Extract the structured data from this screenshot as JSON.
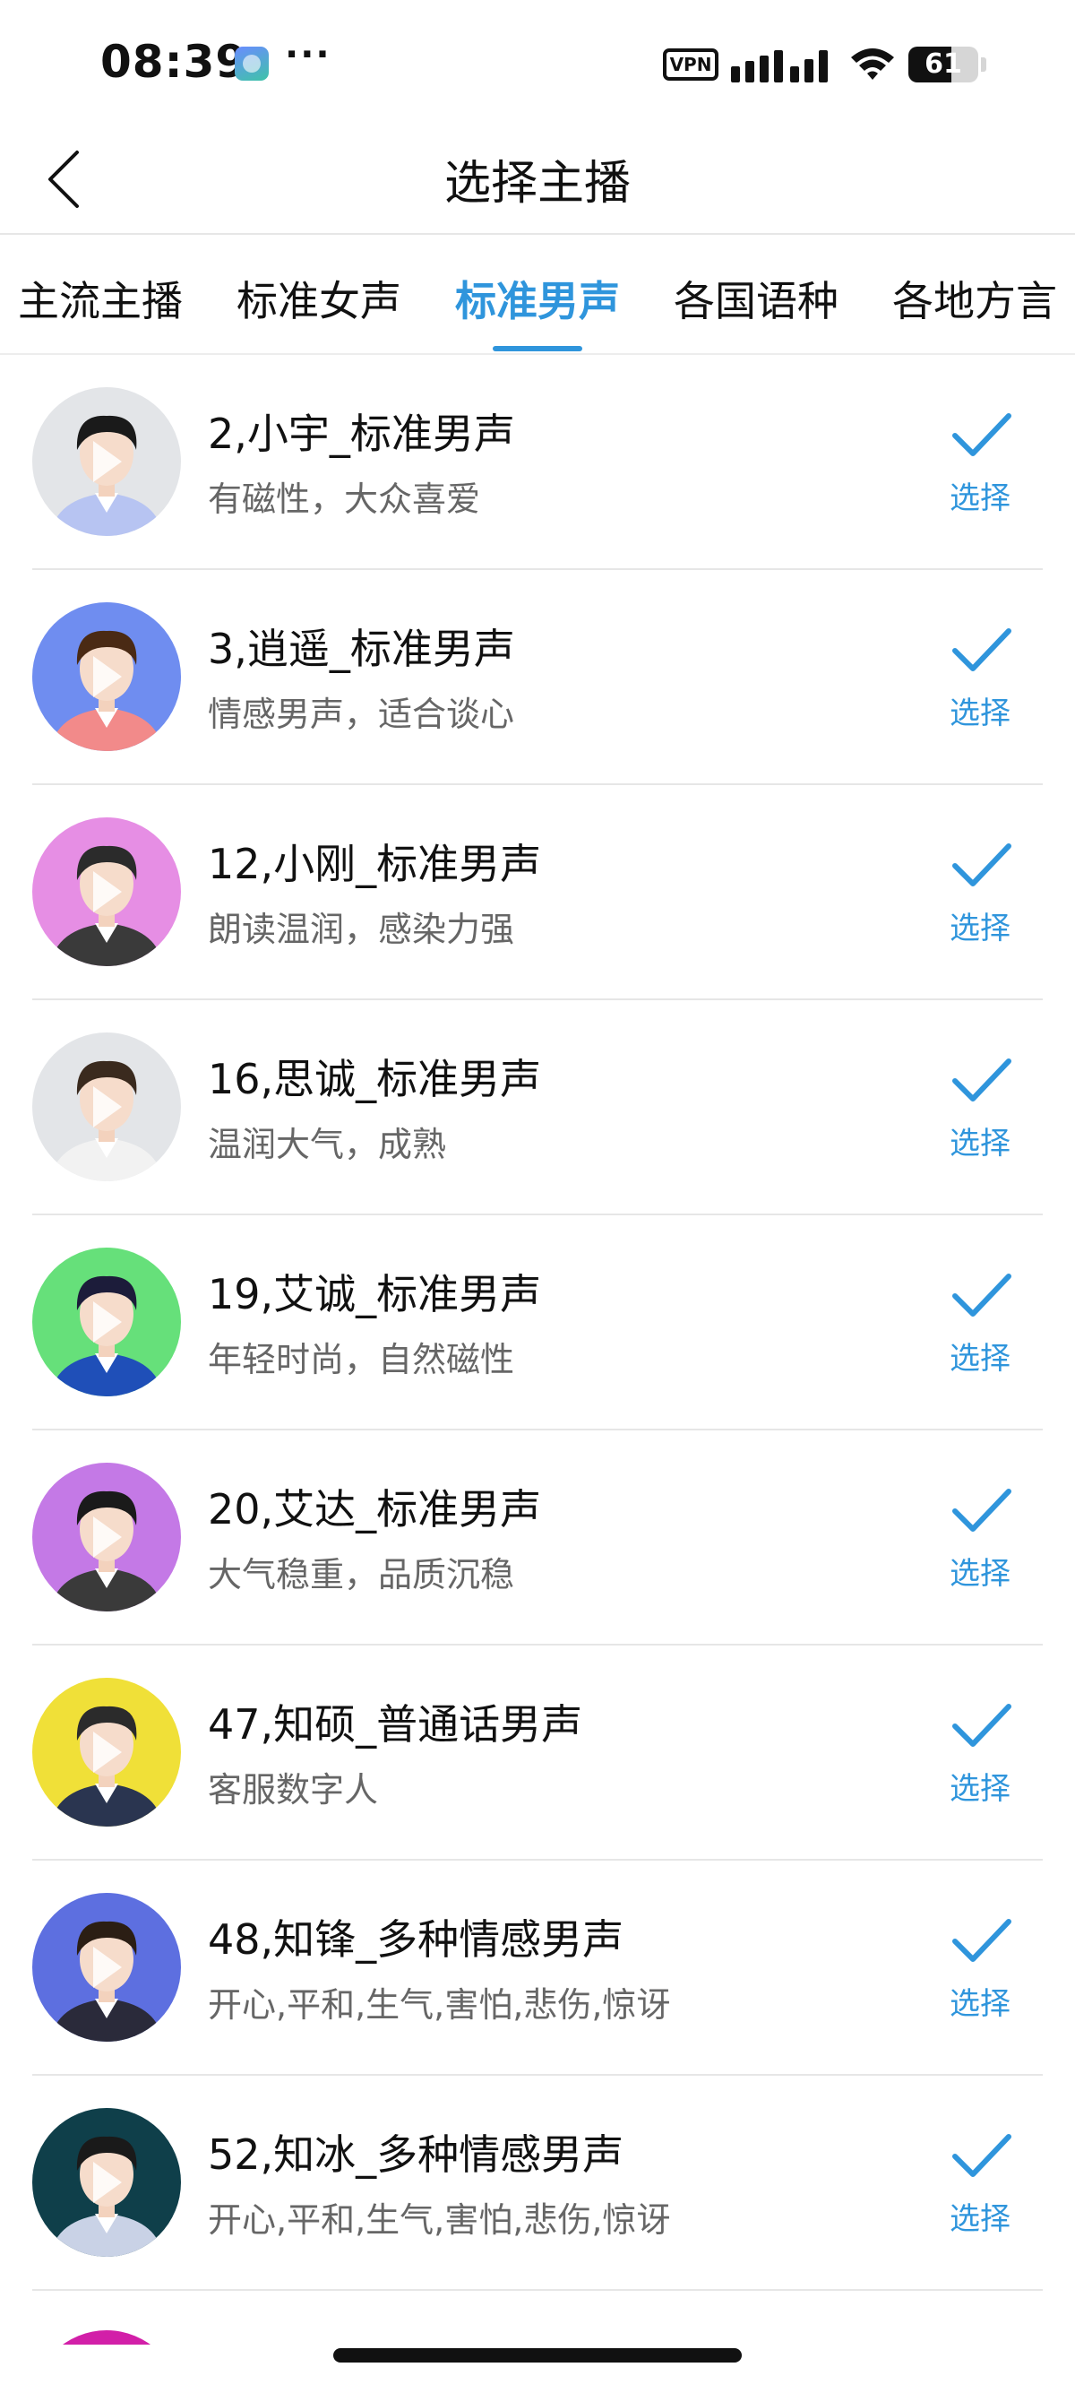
{
  "status_bar": {
    "time": "08:39",
    "dots": "···",
    "vpn_label": "VPN",
    "battery_level": "61",
    "battery_fraction": 0.61
  },
  "nav": {
    "title": "选择主播",
    "back_icon": "chevron-left-icon"
  },
  "tabs": [
    {
      "label": "主流主播",
      "active": false
    },
    {
      "label": "标准女声",
      "active": false
    },
    {
      "label": "标准男声",
      "active": true
    },
    {
      "label": "各国语种",
      "active": false
    },
    {
      "label": "各地方言",
      "active": false
    }
  ],
  "anchors": [
    {
      "name": "2,小宇_标准男声",
      "desc": "有磁性，大众喜爱",
      "select_label": "选择",
      "avatar_bg": "#e3e5e8",
      "shirt": "#b7c4f2",
      "hair": "#1a1a1a"
    },
    {
      "name": "3,逍遥_标准男声",
      "desc": "情感男声，适合谈心",
      "select_label": "选择",
      "avatar_bg": "#6f8df0",
      "shirt": "#f28a8a",
      "hair": "#4a2a14"
    },
    {
      "name": "12,小刚_标准男声",
      "desc": "朗读温润，感染力强",
      "select_label": "选择",
      "avatar_bg": "#e68ee4",
      "shirt": "#3a3a3a",
      "hair": "#2b2b2b"
    },
    {
      "name": "16,思诚_标准男声",
      "desc": "温润大气，成熟",
      "select_label": "选择",
      "avatar_bg": "#e3e5e8",
      "shirt": "#f2f2f2",
      "hair": "#3a2a1e"
    },
    {
      "name": "19,艾诚_标准男声",
      "desc": "年轻时尚，自然磁性",
      "select_label": "选择",
      "avatar_bg": "#66e07a",
      "shirt": "#1f4fb8",
      "hair": "#1c1c3a"
    },
    {
      "name": "20,艾达_标准男声",
      "desc": "大气稳重，品质沉稳",
      "select_label": "选择",
      "avatar_bg": "#c479e6",
      "shirt": "#3a3a3a",
      "hair": "#1a1a1a"
    },
    {
      "name": "47,知硕_普通话男声",
      "desc": "客服数字人",
      "select_label": "选择",
      "avatar_bg": "#f0e038",
      "shirt": "#2a3550",
      "hair": "#2b2b2b"
    },
    {
      "name": "48,知锋_多种情感男声",
      "desc": "开心,平和,生气,害怕,悲伤,惊讶",
      "select_label": "选择",
      "avatar_bg": "#5d6fe0",
      "shirt": "#2a2a3a",
      "hair": "#2b1e14"
    },
    {
      "name": "52,知冰_多种情感男声",
      "desc": "开心,平和,生气,害怕,悲伤,惊讶",
      "select_label": "选择",
      "avatar_bg": "#0f3f4a",
      "shirt": "#c9d2e6",
      "hair": "#1a1a1a"
    }
  ],
  "theme": {
    "accent": "#2f95dc"
  }
}
